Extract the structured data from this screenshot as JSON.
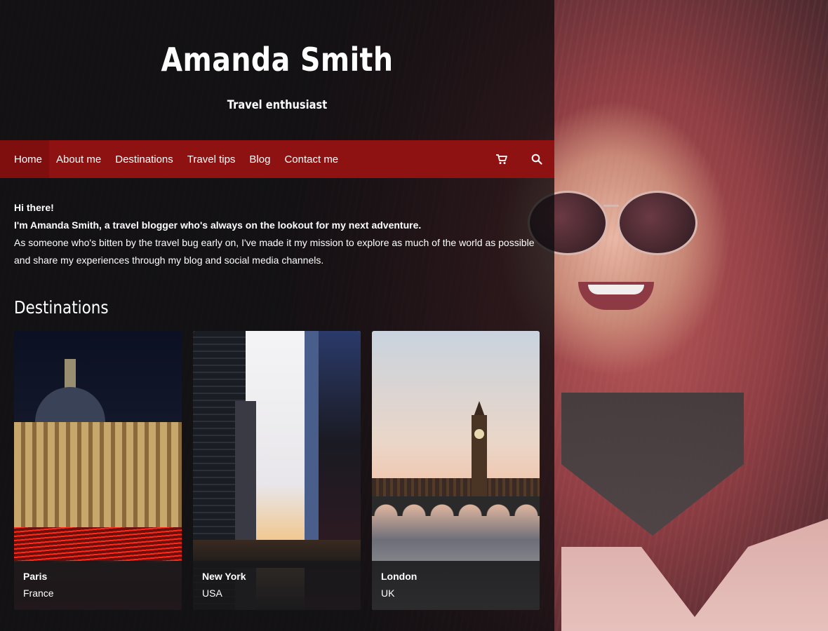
{
  "header": {
    "title": "Amanda Smith",
    "tagline": "Travel enthusiast"
  },
  "nav": {
    "items": [
      "Home",
      "About me",
      "Destinations",
      "Travel tips",
      "Blog",
      "Contact me"
    ],
    "icons": [
      "cart-icon",
      "search-icon"
    ]
  },
  "intro": {
    "greeting": "Hi there!",
    "headline": "I'm Amanda Smith, a travel blogger who's always on the lookout for my next adventure.",
    "body": "As someone who's bitten by the travel bug early on, I've made it my mission to explore as much of the world as possible and share my experiences through my blog and social media channels."
  },
  "destinations": {
    "title": "Destinations",
    "cards": [
      {
        "city": "Paris",
        "country": "France"
      },
      {
        "city": "New York",
        "country": "USA"
      },
      {
        "city": "London",
        "country": "UK"
      }
    ]
  },
  "colors": {
    "nav_bg": "#8e1212",
    "panel_overlay": "rgba(12,12,14,0.78)",
    "text": "#ffffff"
  }
}
